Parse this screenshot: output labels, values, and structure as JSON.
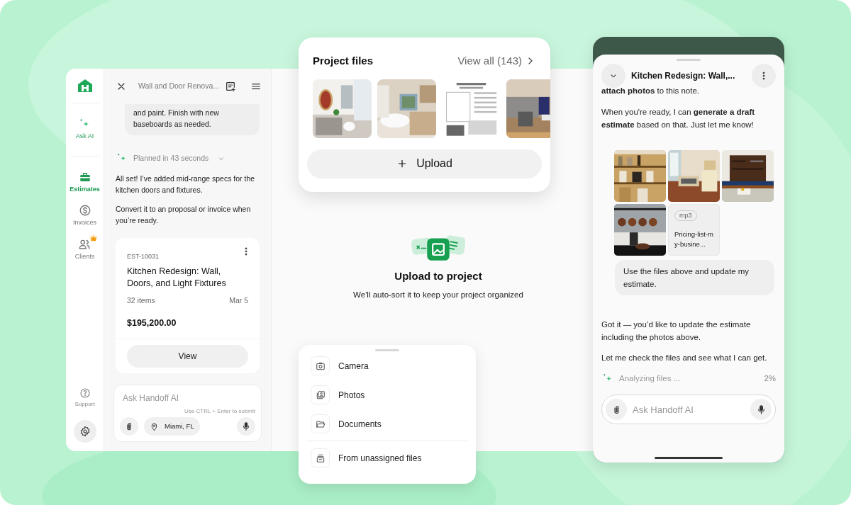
{
  "sidebar": {
    "items": [
      {
        "label": "Ask AI",
        "kind": "ai",
        "selected": false,
        "premium": false
      },
      {
        "label": "Estimates",
        "kind": "estimates",
        "selected": true,
        "premium": false
      },
      {
        "label": "Invoices",
        "kind": "invoices",
        "selected": false,
        "premium": false
      },
      {
        "label": "Clients",
        "kind": "clients",
        "selected": false,
        "premium": true
      }
    ],
    "support": "Support"
  },
  "chat": {
    "title": "Wall and Door Renova...",
    "user_message": "and paint. Finish with new baseboards as needed.",
    "thinking": "Planned in 43 seconds",
    "messages": [
      "All set! I’ve added mid-range specs for the kitchen doors and fixtures.",
      "Convert it to an proposal or invoice when you’re ready."
    ],
    "estimate_card": {
      "number": "EST-10031",
      "title": "Kitchen Redesign: Wall, Doors, and Light Fixtures",
      "items": "32 items",
      "date": "Mar 5",
      "total": "$195,200.00",
      "button": "View"
    },
    "composer": {
      "placeholder": "Ask Handoff AI",
      "hint": "Use CTRL + Enter to submit",
      "location": "Miami, FL"
    }
  },
  "upload": {
    "title": "Upload to project",
    "subtitle": "We'll auto-sort it to keep your project organized"
  },
  "project_files": {
    "title": "Project files",
    "view_all": "View all (143)",
    "thumbnails": [
      {
        "kind": "picture"
      },
      {
        "kind": "picture"
      },
      {
        "kind": "picture"
      },
      {
        "kind": "picture"
      }
    ],
    "upload_button": "Upload"
  },
  "upload_sheet": {
    "options": [
      {
        "label": "Camera",
        "kind": "camera"
      },
      {
        "label": "Photos",
        "kind": "photos"
      },
      {
        "label": "Documents",
        "kind": "documents"
      }
    ],
    "more_options": [
      {
        "label": "From unassigned files",
        "kind": "unassigned"
      }
    ]
  },
  "phone": {
    "title": "Kitchen Redesign: Wall,...",
    "messages": [
      "**attach photos** to this note.",
      "When you're ready, I can **generate a draft estimate** based on that. Just let me know!"
    ],
    "attachments": [
      {
        "kind": "picture"
      },
      {
        "kind": "picture"
      },
      {
        "kind": "picture"
      },
      {
        "kind": "picture"
      },
      {
        "kind": "file",
        "tag": "mp3",
        "name": "Pricing-list-my-busine..."
      }
    ],
    "user_message": "Use the files above and update my estimate.",
    "replies": [
      "Got it — you’d like to update the estimate including the photos above.",
      "Let me check the files and see what I can get."
    ],
    "status": {
      "label": "Analyzing files ...",
      "percent": "2%"
    },
    "composer": {
      "placeholder": "Ask Handoff AI"
    }
  }
}
